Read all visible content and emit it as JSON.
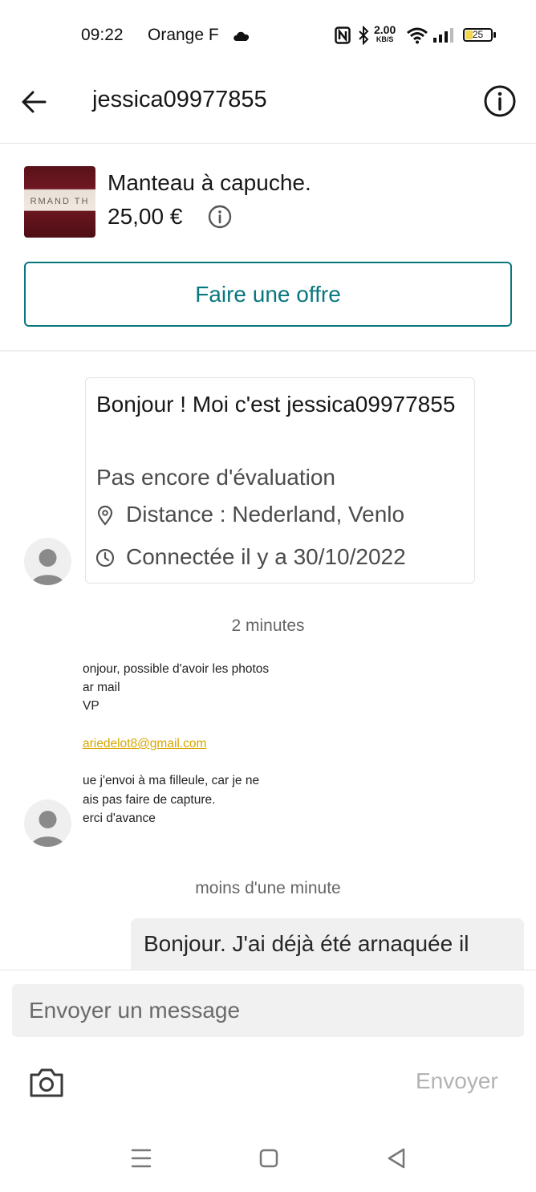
{
  "status_bar": {
    "time": "09:22",
    "carrier": "Orange F",
    "speed_value": "2.00",
    "speed_unit": "KB/S",
    "battery": "25"
  },
  "header": {
    "title": "jessica09977855",
    "back_icon": "arrow-left-icon",
    "info_icon": "info-circle-icon"
  },
  "item": {
    "thumbnail_text": "RMAND TH",
    "title": "Manteau à capuche.",
    "price": "25,00 €"
  },
  "offer_button_label": "Faire une offre",
  "chat": {
    "profile_card": {
      "greeting": "Bonjour ! Moi c'est jessica09977855",
      "rating": "Pas encore d'évaluation",
      "distance": "Distance : Nederland, Venlo",
      "last_seen": "Connectée il y a 30/10/2022"
    },
    "timestamp_1": "2 minutes",
    "screenshot_lines": [
      "onjour, possible d'avoir les photos",
      "ar mail",
      "VP",
      "ariedelot8@gmail.com",
      "ue j'envoi à ma filleule, car je ne",
      "ais pas faire de capture.",
      "erci d'avance"
    ],
    "timestamp_2": "moins d'une minute",
    "my_message": "Bonjour. J'ai déjà été arnaquée il"
  },
  "composer": {
    "placeholder": "Envoyer un message",
    "send_label": "Envoyer"
  },
  "colors": {
    "accent": "#09777f",
    "link": "#d8a600",
    "bubble": "#f0f0f0",
    "disabled_text": "#b3b3b3"
  }
}
